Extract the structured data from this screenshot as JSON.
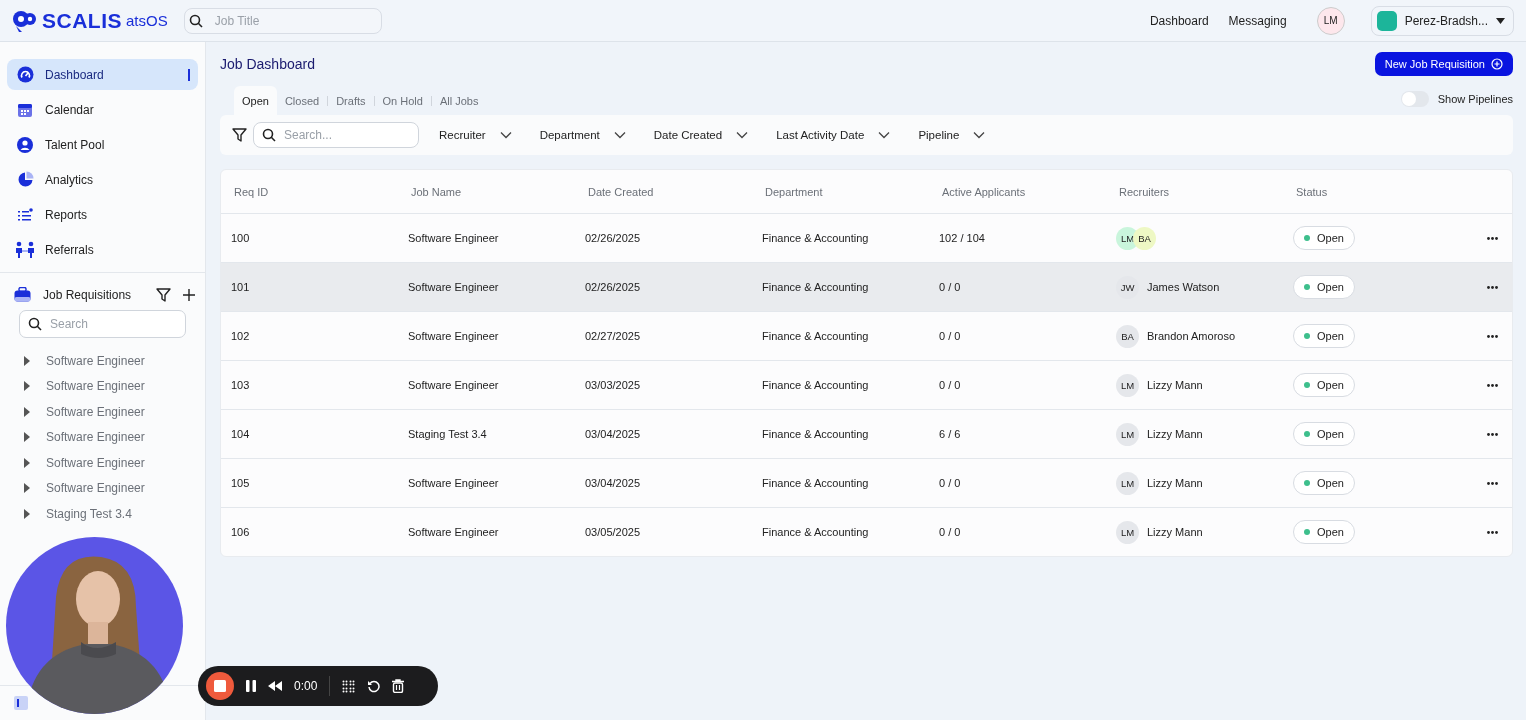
{
  "topbar": {
    "logo": "SCALIS",
    "logo_suffix": "atsOS",
    "search": {
      "placeholder": "Job Title"
    },
    "nav": [
      "Dashboard",
      "Messaging"
    ],
    "avatar": "LM",
    "company": "Perez-Bradsh..."
  },
  "sidebar": {
    "items": [
      {
        "label": "Dashboard",
        "kind": "gauge",
        "selected": true
      },
      {
        "label": "Calendar",
        "kind": "calendar",
        "selected": false
      },
      {
        "label": "Talent Pool",
        "kind": "person",
        "selected": false
      },
      {
        "label": "Analytics",
        "kind": "pie",
        "selected": false
      },
      {
        "label": "Reports",
        "kind": "list",
        "selected": false
      },
      {
        "label": "Referrals",
        "kind": "people",
        "selected": false
      }
    ],
    "section": {
      "title": "Job Requisitions",
      "search": {
        "placeholder": "Search"
      },
      "tree": [
        {
          "label": "Software Engineer",
          "expanded": false
        },
        {
          "label": "Software Engineer",
          "expanded": false
        },
        {
          "label": "Software Engineer",
          "expanded": false
        },
        {
          "label": "Software Engineer",
          "expanded": false
        },
        {
          "label": "Software Engineer",
          "expanded": false
        },
        {
          "label": "Software Engineer",
          "expanded": false
        },
        {
          "label": "Staging Test 3.4",
          "expanded": false
        }
      ]
    }
  },
  "page": {
    "title": "Job Dashboard",
    "new_button": "New Job Requisition",
    "tabs": [
      {
        "label": "Open",
        "selected": true
      },
      {
        "label": "Closed",
        "selected": false
      },
      {
        "label": "Drafts",
        "selected": false
      },
      {
        "label": "On Hold",
        "selected": false
      },
      {
        "label": "All Jobs",
        "selected": false
      }
    ],
    "toggle": {
      "label": "Show Pipelines",
      "on": false
    },
    "filters": {
      "search": {
        "placeholder": "Search..."
      },
      "dropdowns": [
        "Recruiter",
        "Department",
        "Date Created",
        "Last Activity Date",
        "Pipeline"
      ]
    }
  },
  "table": {
    "columns": [
      "Req ID",
      "Job Name",
      "Date Created",
      "Department",
      "Active Applicants",
      "Recruiters",
      "Status"
    ],
    "rows": [
      {
        "req_id": "100",
        "job_name": "Software Engineer",
        "date_created": "02/26/2025",
        "department": "Finance & Accounting",
        "active_applicants": "102 / 104",
        "recruiters": [
          {
            "initials": "LM",
            "color": "#c9f5dc"
          },
          {
            "initials": "BA",
            "color": "#eef8c4"
          }
        ],
        "status": {
          "label": "Open",
          "color": "#3dbf8c"
        },
        "hovered": false
      },
      {
        "req_id": "101",
        "job_name": "Software Engineer",
        "date_created": "02/26/2025",
        "department": "Finance & Accounting",
        "active_applicants": "0 / 0",
        "recruiters": [
          {
            "initials": "JW",
            "name": "James Watson",
            "color": "#e5e7eb"
          }
        ],
        "status": {
          "label": "Open",
          "color": "#3dbf8c"
        },
        "hovered": true
      },
      {
        "req_id": "102",
        "job_name": "Software Engineer",
        "date_created": "02/27/2025",
        "department": "Finance & Accounting",
        "active_applicants": "0 / 0",
        "recruiters": [
          {
            "initials": "BA",
            "name": "Brandon Amoroso",
            "color": "#e5e7eb"
          }
        ],
        "status": {
          "label": "Open",
          "color": "#3dbf8c"
        },
        "hovered": false
      },
      {
        "req_id": "103",
        "job_name": "Software Engineer",
        "date_created": "03/03/2025",
        "department": "Finance & Accounting",
        "active_applicants": "0 / 0",
        "recruiters": [
          {
            "initials": "LM",
            "name": "Lizzy Mann",
            "color": "#e5e7eb"
          }
        ],
        "status": {
          "label": "Open",
          "color": "#3dbf8c"
        },
        "hovered": false
      },
      {
        "req_id": "104",
        "job_name": "Staging Test 3.4",
        "date_created": "03/04/2025",
        "department": "Finance & Accounting",
        "active_applicants": "6 / 6",
        "recruiters": [
          {
            "initials": "LM",
            "name": "Lizzy Mann",
            "color": "#e5e7eb"
          }
        ],
        "status": {
          "label": "Open",
          "color": "#3dbf8c"
        },
        "hovered": false
      },
      {
        "req_id": "105",
        "job_name": "Software Engineer",
        "date_created": "03/04/2025",
        "department": "Finance & Accounting",
        "active_applicants": "0 / 0",
        "recruiters": [
          {
            "initials": "LM",
            "name": "Lizzy Mann",
            "color": "#e5e7eb"
          }
        ],
        "status": {
          "label": "Open",
          "color": "#3dbf8c"
        },
        "hovered": false
      },
      {
        "req_id": "106",
        "job_name": "Software Engineer",
        "date_created": "03/05/2025",
        "department": "Finance & Accounting",
        "active_applicants": "0 / 0",
        "recruiters": [
          {
            "initials": "LM",
            "name": "Lizzy Mann",
            "color": "#e5e7eb"
          }
        ],
        "status": {
          "label": "Open",
          "color": "#3dbf8c"
        },
        "hovered": false
      }
    ]
  },
  "recorder": {
    "time": "0:00"
  }
}
